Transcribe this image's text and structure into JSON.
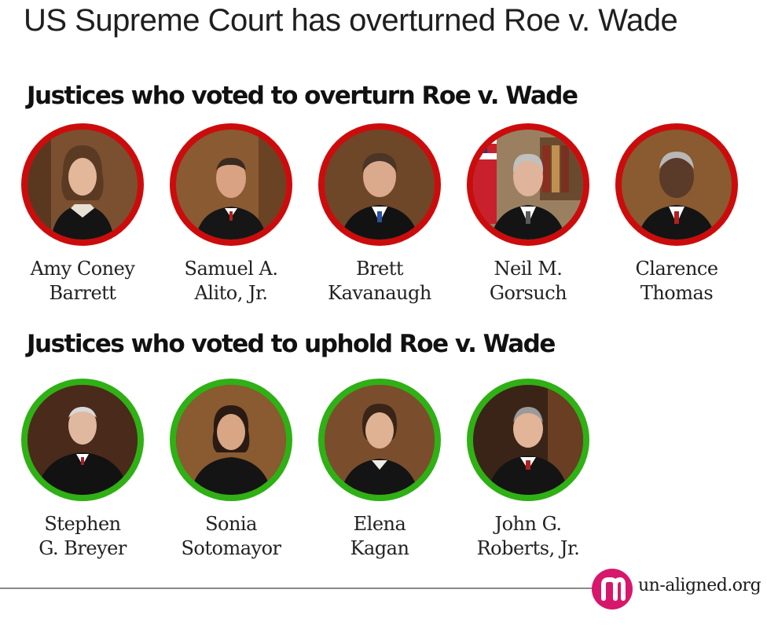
{
  "title": "US Supreme Court has overturned Roe v. Wade",
  "sections": {
    "overturn": {
      "heading": "Justices who voted to overturn Roe v. Wade",
      "ring_color": "#cc0c0c",
      "justices": [
        {
          "line1": "Amy Coney",
          "line2": "Barrett"
        },
        {
          "line1": "Samuel A.",
          "line2": "Alito, Jr."
        },
        {
          "line1": "Brett",
          "line2": "Kavanaugh"
        },
        {
          "line1": "Neil M.",
          "line2": "Gorsuch"
        },
        {
          "line1": "Clarence",
          "line2": "Thomas"
        }
      ]
    },
    "uphold": {
      "heading": "Justices who voted to uphold Roe v. Wade",
      "ring_color": "#2fb015",
      "justices": [
        {
          "line1": "Stephen",
          "line2": "G. Breyer"
        },
        {
          "line1": "Sonia",
          "line2": "Sotomayor"
        },
        {
          "line1": "Elena",
          "line2": "Kagan"
        },
        {
          "line1": "John G.",
          "line2": "Roberts, Jr."
        }
      ]
    }
  },
  "footer": {
    "logo_text": "un-aligned.org",
    "logo_color": "#d6176b"
  }
}
